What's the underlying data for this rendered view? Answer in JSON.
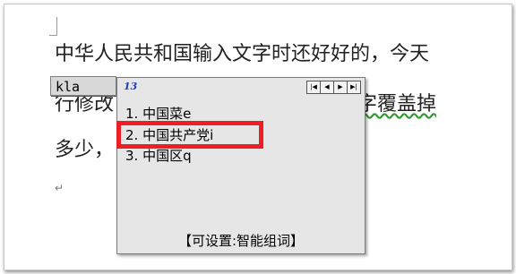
{
  "document": {
    "line1": "中华人民共和国输入文字时还好好的，今天",
    "line2": "行修改",
    "line2_right": "把旧字覆盖掉",
    "line3": "多少，",
    "paragraph_mark": "↵"
  },
  "ime": {
    "composition": "kla",
    "logo": "13",
    "pager": [
      "|◀",
      "◀",
      "▶",
      "▶|"
    ],
    "candidates": [
      {
        "label": "1. 中国菜e"
      },
      {
        "label": "2. 中国共产党i"
      },
      {
        "label": "3. 中国区q"
      }
    ],
    "hint": "【可设置:智能组词】"
  },
  "colors": {
    "highlight_border": "#ee1e26",
    "grammar_underline": "#2e9a2e",
    "logo": "#1a3ec8"
  }
}
